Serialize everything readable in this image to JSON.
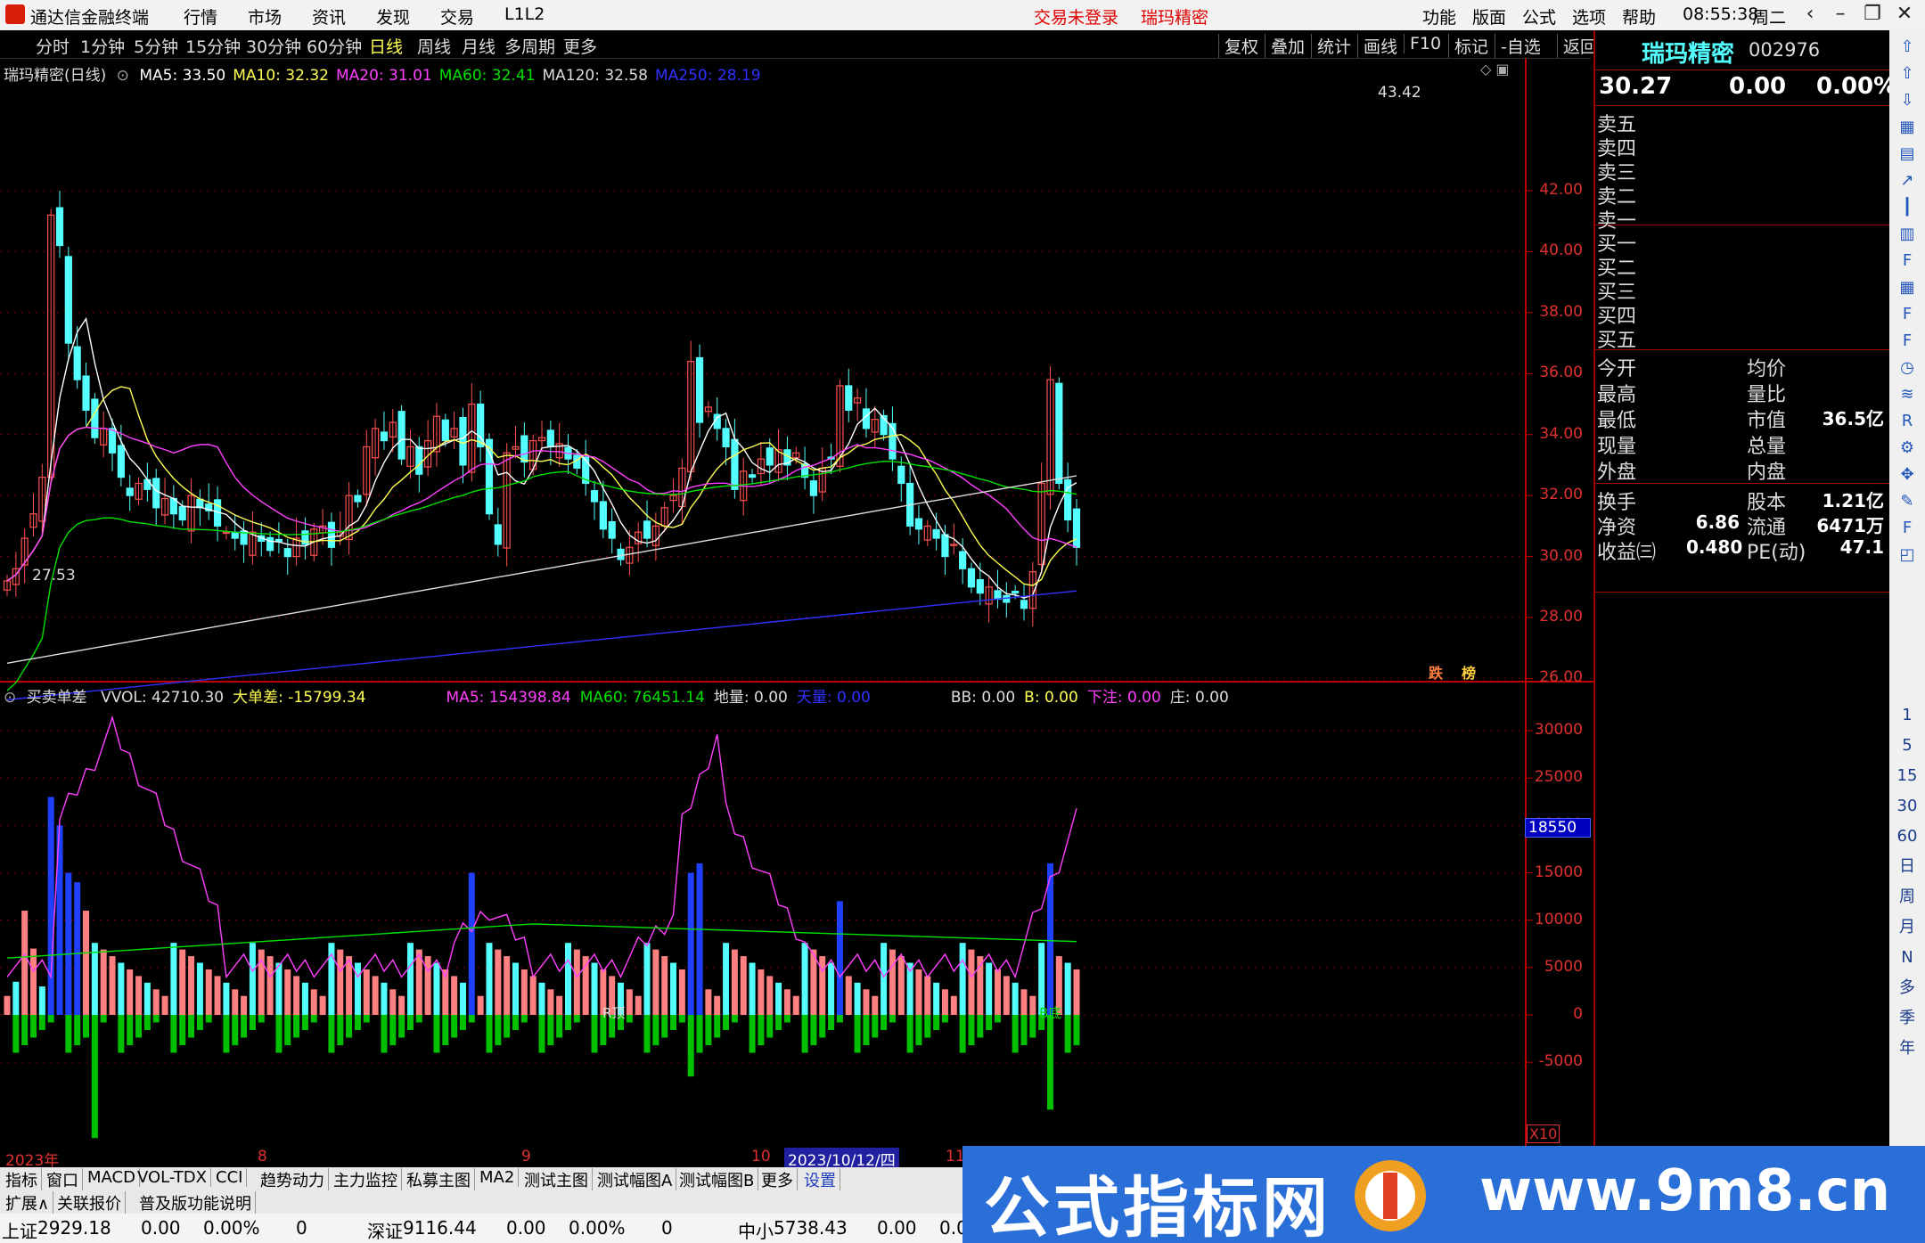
{
  "app": {
    "title": "通达信金融终端",
    "menu": [
      "行情",
      "市场",
      "资讯",
      "发现",
      "交易",
      "L1L2"
    ],
    "login_status": "交易未登录",
    "stock_name_title": "瑞玛精密",
    "right_menu": [
      "功能",
      "版面",
      "公式",
      "选项",
      "帮助"
    ],
    "clock": "08:55:38",
    "weekday": "周二"
  },
  "periods": [
    "分时",
    "1分钟",
    "5分钟",
    "15分钟",
    "30分钟",
    "60分钟",
    "日线",
    "周线",
    "月线",
    "多周期",
    "更多"
  ],
  "active_period": "日线",
  "chart_tools": [
    "复权",
    "叠加",
    "统计",
    "画线",
    "F10",
    "标记",
    "-自选",
    "返回"
  ],
  "main_chart": {
    "label": "瑞玛精密(日线)",
    "ma": [
      {
        "name": "MA5: 33.50",
        "color": "#ffffff"
      },
      {
        "name": "MA10: 32.32",
        "color": "#ffff54"
      },
      {
        "name": "MA20: 31.01",
        "color": "#ff40ff"
      },
      {
        "name": "MA60: 32.41",
        "color": "#00e000"
      },
      {
        "name": "MA120: 32.58",
        "color": "#dddddd"
      },
      {
        "name": "MA250: 28.19",
        "color": "#3030ff"
      }
    ],
    "high_label": "43.42",
    "low_label": "27.53",
    "markers": [
      "跌",
      "榜"
    ]
  },
  "sub_chart": {
    "label": "买卖单差",
    "items": [
      {
        "text": "VVOL: 42710.30",
        "color": "#dddddd"
      },
      {
        "text": "大单差: -15799.34",
        "color": "#ffff54"
      },
      {
        "text": "MA5: 154398.84",
        "color": "#ff40ff"
      },
      {
        "text": "MA60: 76451.14",
        "color": "#00e000"
      },
      {
        "text": "地量: 0.00",
        "color": "#dddddd"
      },
      {
        "text": "天量: 0.00",
        "color": "#3030ff"
      },
      {
        "text": "BB: 0.00",
        "color": "#dddddd"
      },
      {
        "text": "B: 0.00",
        "color": "#ffff54"
      },
      {
        "text": "下注: 0.00",
        "color": "#ff40ff"
      },
      {
        "text": "庄: 0.00",
        "color": "#dddddd"
      }
    ],
    "current_value": "18550",
    "scale": "X10",
    "marks": [
      "R顶",
      "B底"
    ]
  },
  "price_axis": [
    "42.00",
    "40.00",
    "38.00",
    "36.00",
    "34.00",
    "32.00",
    "30.00",
    "28.00",
    "26.00"
  ],
  "vol_axis": [
    "30000",
    "25000",
    "20000",
    "15000",
    "10000",
    "5000",
    "0",
    "-5000"
  ],
  "date_axis": [
    {
      "text": "2023年"
    },
    {
      "text": "8"
    },
    {
      "text": "9"
    },
    {
      "text": "10"
    },
    {
      "text": "2023/10/12/四"
    },
    {
      "text": "11"
    }
  ],
  "quote": {
    "name": "瑞玛精密",
    "code": "002976",
    "price": "30.27",
    "change": "0.00",
    "pct": "0.00%",
    "sell": [
      "卖五",
      "卖四",
      "卖三",
      "卖二",
      "卖一"
    ],
    "buy": [
      "买一",
      "买二",
      "买三",
      "买四",
      "买五"
    ],
    "stats": [
      {
        "l": "今开",
        "v1": "",
        "l2": "均价",
        "v2": ""
      },
      {
        "l": "最高",
        "v1": "",
        "l2": "量比",
        "v2": ""
      },
      {
        "l": "最低",
        "v1": "",
        "l2": "市值",
        "v2": "36.5亿"
      },
      {
        "l": "现量",
        "v1": "",
        "l2": "总量",
        "v2": ""
      },
      {
        "l": "外盘",
        "v1": "",
        "l2": "内盘",
        "v2": ""
      }
    ],
    "fin": [
      {
        "l": "换手",
        "v1": "",
        "l2": "股本",
        "v2": "1.21亿"
      },
      {
        "l": "净资",
        "v1": "6.86",
        "l2": "流通",
        "v2": "6471万"
      },
      {
        "l": "收益㈢",
        "v1": "0.480",
        "l2": "PE(动)",
        "v2": "47.1"
      }
    ]
  },
  "side_icons": [
    "up-arrow-icon",
    "up-icon",
    "down-icon",
    "chart-icon",
    "table-icon",
    "line-icon",
    "candle-icon",
    "list-icon",
    "f10-icon",
    "grid-icon",
    "f-icon",
    "f2-icon",
    "clock-icon",
    "wave-icon",
    "rsi-icon",
    "gear-icon",
    "move-icon",
    "pen-icon",
    "fs-icon",
    "layers-icon"
  ],
  "side_periods": [
    "1",
    "5",
    "15",
    "30",
    "60",
    "日",
    "周",
    "月",
    "N",
    "多",
    "季",
    "年"
  ],
  "bottom_tabs": [
    "指标",
    "窗口",
    "MACD",
    "VOL-TDX",
    "CCI",
    "趋势动力",
    "主力监控",
    "私募主图",
    "MA2",
    "测试主图",
    "测试幅图A",
    "测试幅图B",
    "更多",
    "设置"
  ],
  "bottom_tabs2": [
    "扩展∧",
    "关联报价",
    "普及版功能说明"
  ],
  "indices": [
    {
      "name": "上证",
      "value": "2929.18",
      "chg": "0.00",
      "pct": "0.00%",
      "vol": "0"
    },
    {
      "name": "深证",
      "value": "9116.44",
      "chg": "0.00",
      "pct": "0.00%",
      "vol": "0"
    },
    {
      "name": "中小",
      "value": "5738.43",
      "chg": "0.00",
      "pct": "0.0"
    }
  ],
  "banner": {
    "title": "公式指标网",
    "url": "www.9m8.cn"
  },
  "colors": {
    "up": "#ff5050",
    "down": "#54ffff",
    "grid": "#7a0000",
    "axis": "#e03030"
  }
}
